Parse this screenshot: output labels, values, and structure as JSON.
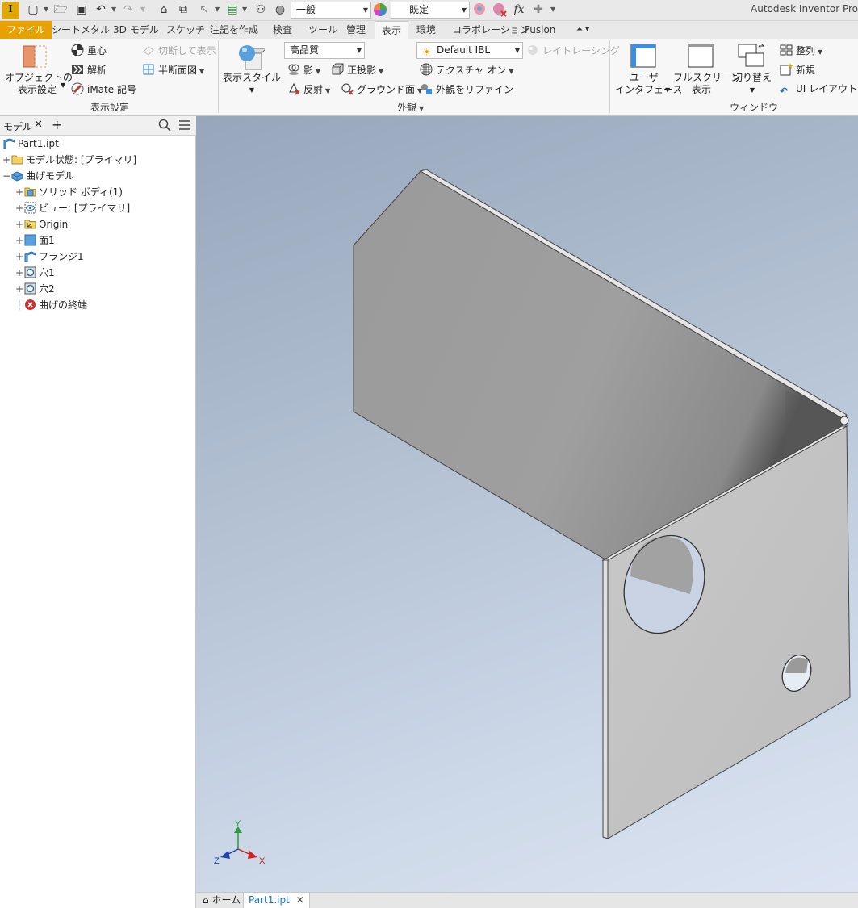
{
  "app": {
    "title": "Autodesk Inventor Pro",
    "logo_letter": "I"
  },
  "quick_access": {
    "material_value": "一般",
    "appearance_value": "既定",
    "fx_label": "fx"
  },
  "tabs": [
    "ファイル",
    "シートメタル",
    "3D モデル",
    "スケッチ",
    "注記を作成",
    "検査",
    "ツール",
    "管理",
    "表示",
    "環境",
    "コラボレーション",
    "Fusion"
  ],
  "active_tab": "表示",
  "ribbon": {
    "visibility": {
      "object_display_line1": "オブジェクトの",
      "object_display_line2": "表示設定",
      "center_of_gravity": "重心",
      "analysis": "解析",
      "imate_glyphs": "iMate 記号",
      "cut_display": "切断して表示",
      "half_section": "半断面図",
      "group_label": "表示設定"
    },
    "appearance": {
      "visual_style": "表示スタイル",
      "quality_value": "高品質",
      "shadows": "影",
      "orthographic": "正投影",
      "reflections": "反射",
      "ground_plane": "グラウンド面",
      "ibl_value": "Default IBL",
      "ray_tracing": "レイトレーシング",
      "textures_on": "テクスチャ オン",
      "refine_appearance": "外観をリファイン",
      "group_label": "外観"
    },
    "windows": {
      "user_interface_line1": "ユーザ",
      "user_interface_line2": "インタフェース",
      "fullscreen_line1": "フルスクリーン",
      "fullscreen_line2": "表示",
      "switch": "切り替え",
      "arrange": "整列",
      "new": "新規",
      "ui_layout": "UI レイアウトを リ",
      "group_label": "ウィンドウ"
    }
  },
  "browser": {
    "tab_label": "モデル",
    "root": "Part1.ipt",
    "items": [
      {
        "label": "モデル状態: [プライマリ]",
        "icon": "folder-icon",
        "level": 0,
        "expander": "+"
      },
      {
        "label": "曲げモデル",
        "icon": "folded-model-icon",
        "level": 0,
        "expander": "−"
      },
      {
        "label": "ソリッド ボディ(1)",
        "icon": "solid-bodies-icon",
        "level": 1,
        "expander": "+"
      },
      {
        "label": "ビュー: [プライマリ]",
        "icon": "view-rep-icon",
        "level": 1,
        "expander": "+"
      },
      {
        "label": "Origin",
        "icon": "origin-icon",
        "level": 1,
        "expander": "+"
      },
      {
        "label": "面1",
        "icon": "face-icon",
        "level": 1,
        "expander": "+"
      },
      {
        "label": "フランジ1",
        "icon": "flange-icon",
        "level": 1,
        "expander": "+"
      },
      {
        "label": "穴1",
        "icon": "hole-icon",
        "level": 1,
        "expander": "+"
      },
      {
        "label": "穴2",
        "icon": "hole-icon",
        "level": 1,
        "expander": "+"
      },
      {
        "label": "曲げの終端",
        "icon": "end-of-part-icon",
        "level": 1,
        "expander": ""
      }
    ]
  },
  "triad": {
    "x": "X",
    "y": "Y",
    "z": "Z"
  },
  "doc_tabs": {
    "home": "ホーム",
    "part": "Part1.ipt"
  },
  "colors": {
    "accent": "#e8a200",
    "active_blue": "#1a6fc9"
  }
}
